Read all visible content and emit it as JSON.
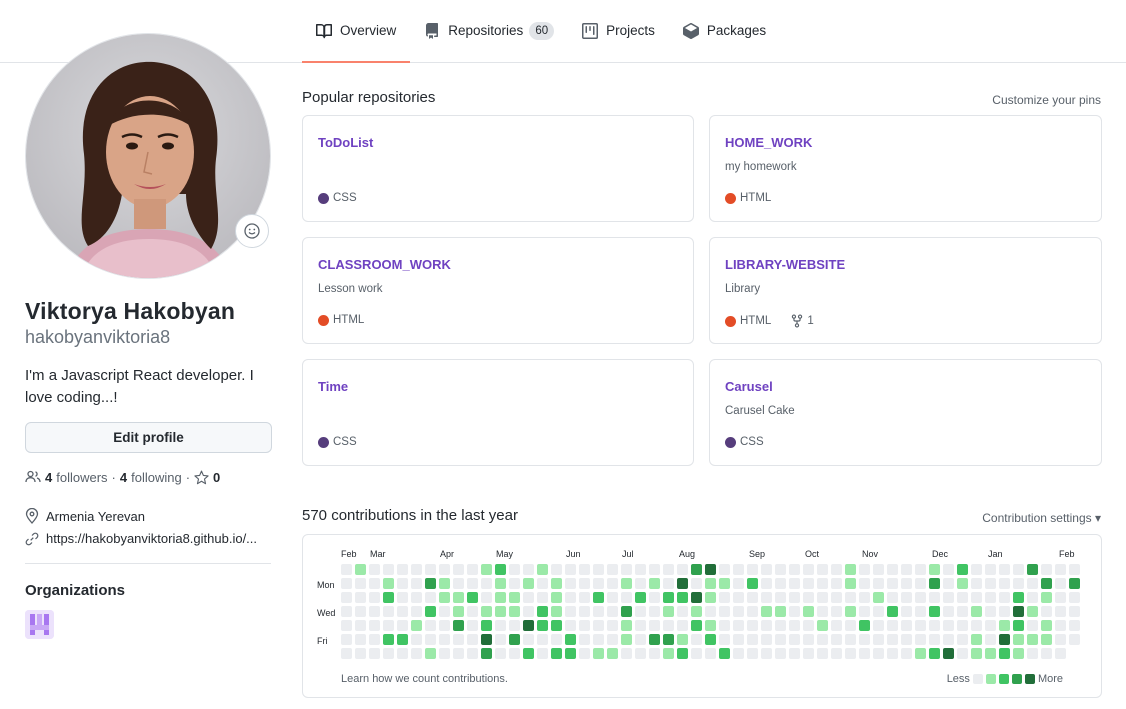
{
  "nav": {
    "tabs": [
      {
        "label": "Overview",
        "icon": "book-icon",
        "active": true
      },
      {
        "label": "Repositories",
        "icon": "repo-icon",
        "count": "60"
      },
      {
        "label": "Projects",
        "icon": "project-icon"
      },
      {
        "label": "Packages",
        "icon": "package-icon"
      }
    ]
  },
  "profile": {
    "fullname": "Viktorya Hakobyan",
    "username": "hakobyanviktoria8",
    "bio": "I'm a Javascript React developer. I love coding...!",
    "edit_label": "Edit profile",
    "followers_count": "4",
    "followers_label": "followers",
    "separator": "·",
    "following_count": "4",
    "following_label": "following",
    "stars_count": "0",
    "location": "Armenia Yerevan",
    "website": "https://hakobyanviktoria8.github.io/..."
  },
  "organizations": {
    "title": "Organizations"
  },
  "pinned": {
    "title": "Popular repositories",
    "customize": "Customize your pins",
    "repos": [
      {
        "name": "ToDoList",
        "description": "",
        "language": "CSS",
        "lang_color": "#563d7c"
      },
      {
        "name": "HOME_WORK",
        "description": "my homework",
        "language": "HTML",
        "lang_color": "#e34c26"
      },
      {
        "name": "CLASSROOM_WORK",
        "description": "Lesson work",
        "language": "HTML",
        "lang_color": "#e34c26"
      },
      {
        "name": "LIBRARY-WEBSITE",
        "description": "Library",
        "language": "HTML",
        "lang_color": "#e34c26",
        "forks": "1"
      },
      {
        "name": "Time",
        "description": "",
        "language": "CSS",
        "lang_color": "#563d7c"
      },
      {
        "name": "Carusel",
        "description": "Carusel Cake",
        "language": "CSS",
        "lang_color": "#563d7c"
      }
    ]
  },
  "contributions": {
    "title": "570 contributions in the last year",
    "settings": "Contribution settings ▾",
    "months": [
      "Feb",
      "Mar",
      "Apr",
      "May",
      "Jun",
      "Jul",
      "Aug",
      "Sep",
      "Oct",
      "Nov",
      "Dec",
      "Jan",
      "Feb"
    ],
    "weekdays": [
      "Mon",
      "Wed",
      "Fri"
    ],
    "learn": "Learn how we count contributions.",
    "less": "Less",
    "more": "More",
    "colors": [
      "#ebedf0",
      "#9be9a8",
      "#40c463",
      "#30a14e",
      "#216e39"
    ]
  }
}
